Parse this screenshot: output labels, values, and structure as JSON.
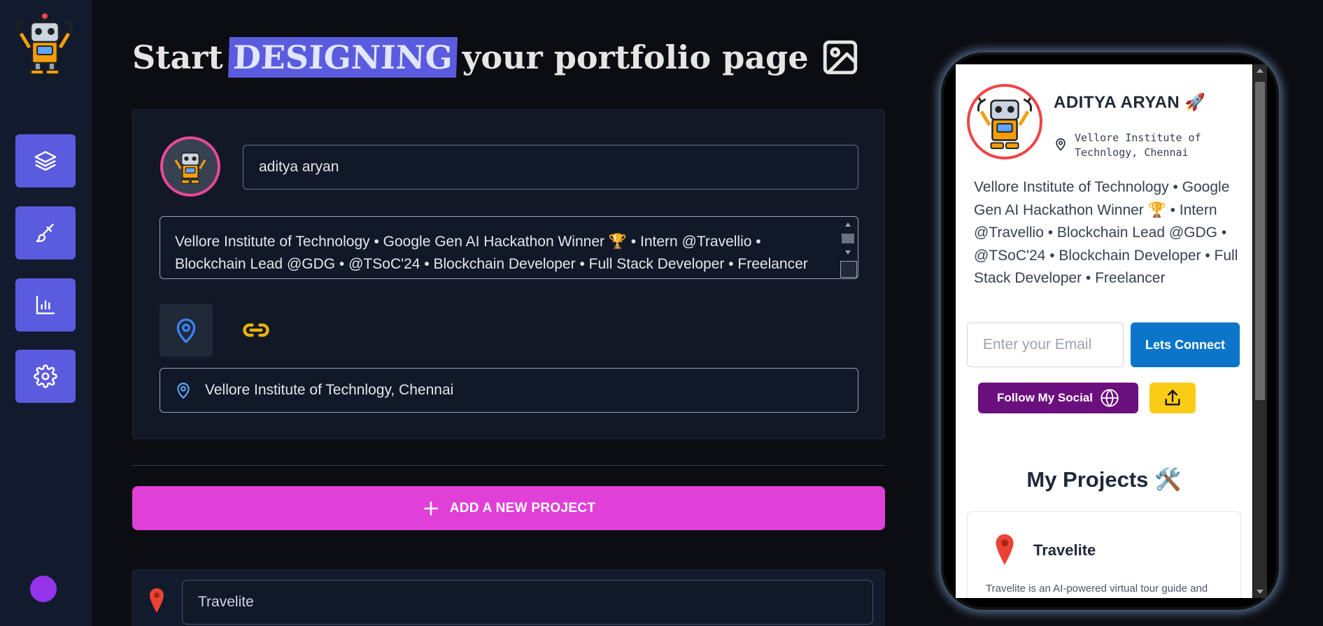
{
  "title": {
    "start": "Start",
    "highlight": "DESIGNING",
    "rest": "your portfolio page"
  },
  "sidebar": {
    "items": [
      {
        "icon": "layers-icon"
      },
      {
        "icon": "brush-icon"
      },
      {
        "icon": "bar-chart-icon"
      },
      {
        "icon": "gear-icon"
      }
    ],
    "accent": "#5b5bdf"
  },
  "editor": {
    "name_value": "aditya aryan",
    "bio_value": "Vellore Institute of Technology • Google Gen AI Hackathon Winner 🏆 • Intern @Travellio • Blockchain Lead @GDG • @TSoC'24 • Blockchain Developer • Full Stack Developer • Freelancer",
    "location_value": "Vellore Institute of Technlogy, Chennai"
  },
  "add_project_label": "ADD A NEW PROJECT",
  "project": {
    "name_value": "Travelite"
  },
  "preview": {
    "name": "ADITYA ARYAN 🚀",
    "location": "Vellore Institute of Technlogy, Chennai",
    "bio": "Vellore Institute of Technology • Google Gen AI Hackathon Winner 🏆 • Intern @Travellio • Blockchain Lead @GDG • @TSoC'24 • Blockchain Developer • Full Stack Developer • Freelancer",
    "email_placeholder": "Enter your Email",
    "connect_label": "Lets Connect",
    "social_label": "Follow My Social",
    "projects_title": "My Projects 🛠️",
    "project_name": "Travelite",
    "project_desc": "Travelite is an AI-powered virtual tour guide and travel assistant platform that provides"
  },
  "colors": {
    "add_button": "#e040d8",
    "connect": "#0b76c9",
    "social": "#6b0f7e",
    "share": "#facc15"
  }
}
